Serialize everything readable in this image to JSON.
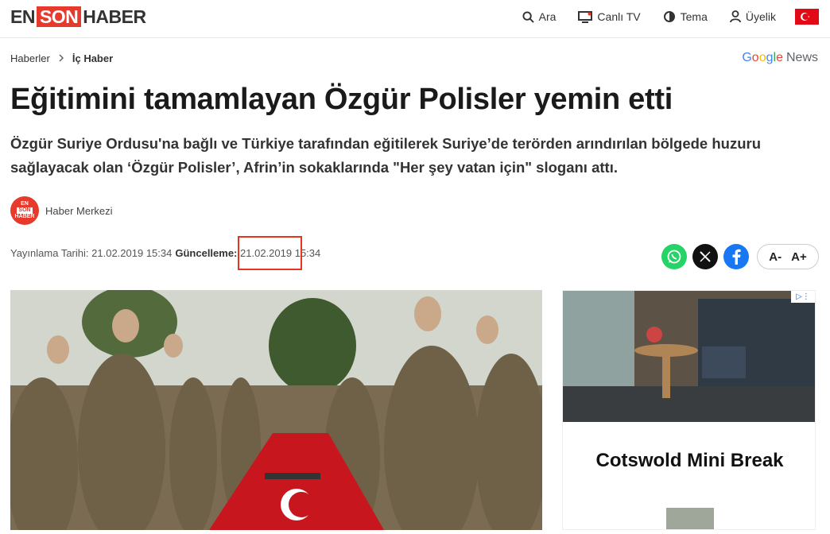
{
  "logo": {
    "part1": "EN",
    "part2": "SON",
    "part3": "HABER"
  },
  "nav": {
    "search": "Ara",
    "live_tv": "Canlı TV",
    "theme": "Tema",
    "membership": "Üyelik"
  },
  "breadcrumb": {
    "home": "Haberler",
    "current": "İç Haber"
  },
  "google_news": {
    "google": "Google",
    "news": "News"
  },
  "article": {
    "title": "Eğitimini tamamlayan Özgür Polisler yemin etti",
    "lead": "Özgür Suriye Ordusu'na bağlı ve Türkiye tarafından eğitilerek Suriye’de terörden arındırılan bölgede huzuru sağlayacak olan ‘Özgür Polisler’, Afrin’in sokaklarında \"Her şey vatan için\" sloganı attı.",
    "author": "Haber Merkezi",
    "avatar_text": {
      "top": "EN",
      "mid": "SON",
      "bottom": "HABER"
    },
    "published_label": "Yayınlama Tarihi:",
    "published_value": "21.02.2019 15:34",
    "updated_label": "Güncelleme:",
    "updated_date": "21.02.2019",
    "updated_time": "15:34"
  },
  "font_size": {
    "decrease": "A-",
    "increase": "A+"
  },
  "ad": {
    "title": "Cotswold Mini Break"
  },
  "colors": {
    "brand_red": "#e63a2d",
    "highlight": "#e5351f"
  },
  "icons": [
    "search-icon",
    "tv-icon",
    "theme-icon",
    "user-icon",
    "turkey-flag-icon",
    "chevron-right-icon",
    "whatsapp-icon",
    "x-icon",
    "facebook-icon",
    "ad-choices-icon"
  ]
}
